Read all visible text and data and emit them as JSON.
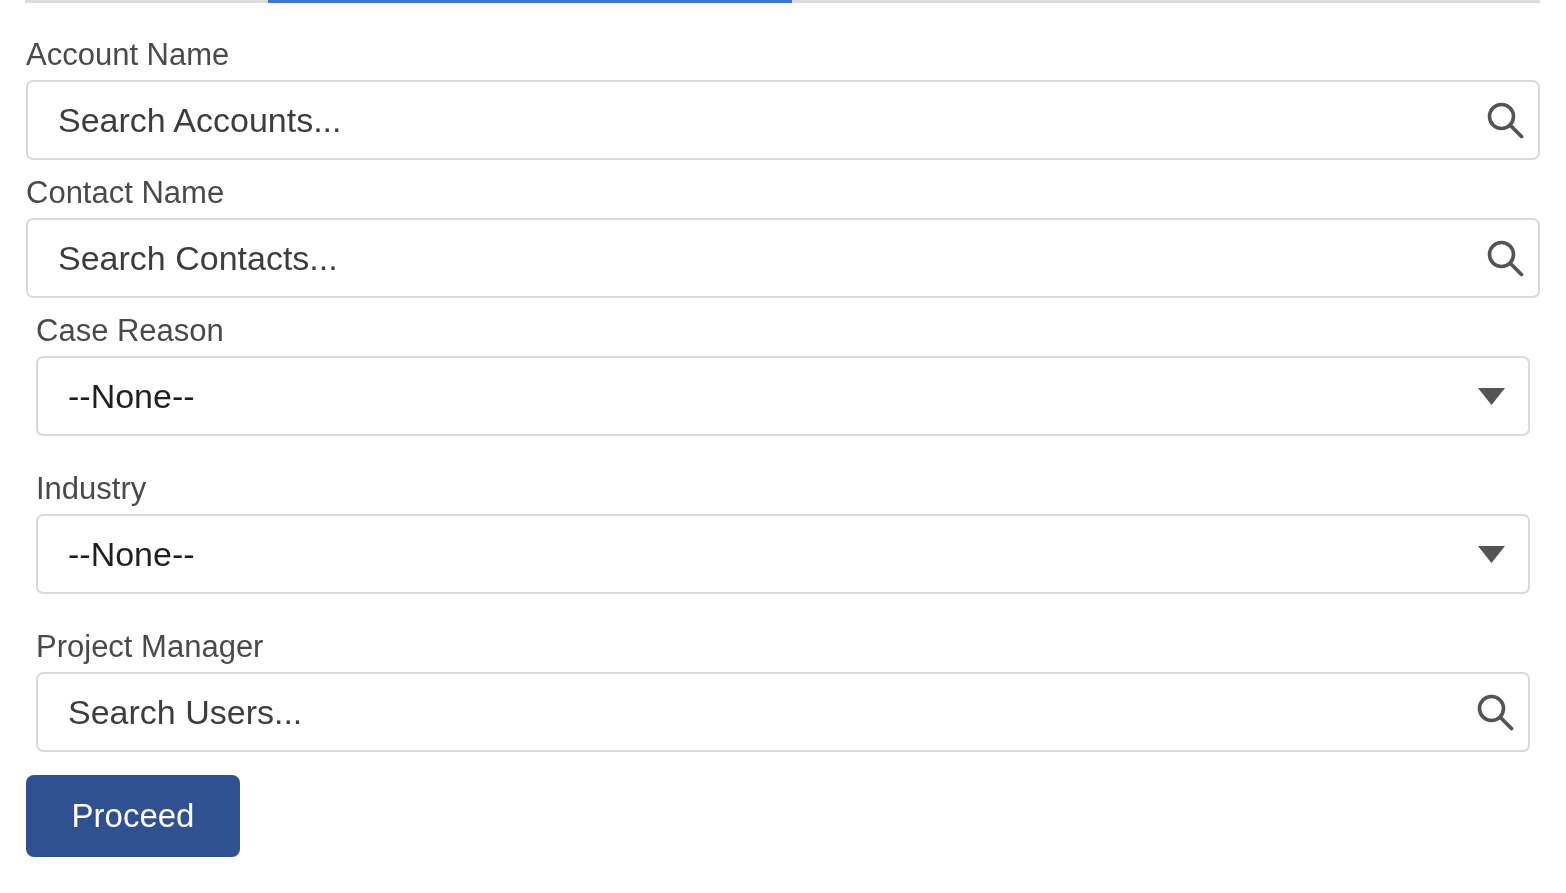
{
  "tab_bar": {
    "tabs": [
      {
        "selected": false
      },
      {
        "selected": true
      },
      {
        "selected": false
      }
    ]
  },
  "sections": [
    {
      "fields": [
        {
          "kind": "lookup",
          "label": "Account Name",
          "placeholder": "Search Accounts..."
        },
        {
          "kind": "lookup",
          "label": "Contact Name",
          "placeholder": "Search Contacts..."
        }
      ]
    },
    {
      "fields": [
        {
          "kind": "picklist",
          "label": "Case Reason",
          "value": "--None--"
        },
        {
          "kind": "picklist",
          "label": "Industry",
          "value": "--None--"
        },
        {
          "kind": "lookup",
          "label": "Project Manager",
          "placeholder": "Search Users..."
        }
      ]
    }
  ],
  "buttons": [
    {
      "label": "Proceed"
    }
  ]
}
